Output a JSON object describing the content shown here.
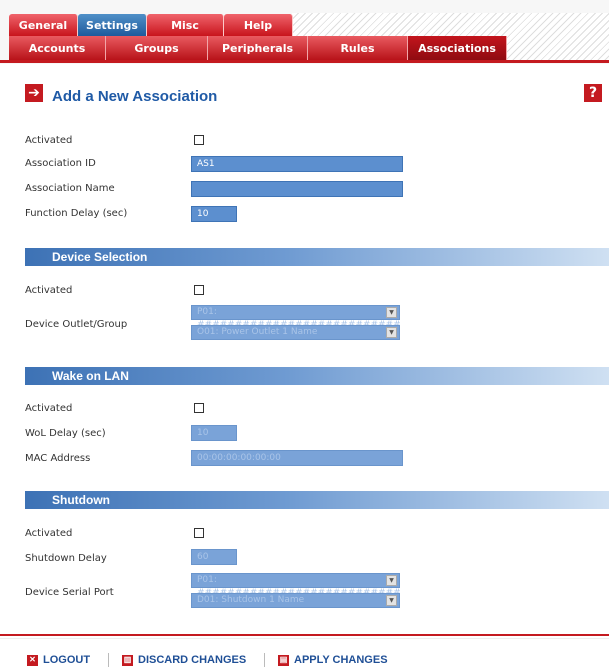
{
  "nav": {
    "primary_tabs": [
      {
        "label": "General",
        "active": false
      },
      {
        "label": "Settings",
        "active": true
      },
      {
        "label": "Misc",
        "active": false
      },
      {
        "label": "Help",
        "active": false
      }
    ],
    "secondary_tabs": [
      {
        "label": "Accounts",
        "active": false
      },
      {
        "label": "Groups",
        "active": false
      },
      {
        "label": "Peripherals",
        "active": false
      },
      {
        "label": "Rules",
        "active": false
      },
      {
        "label": "Associations",
        "active": true
      }
    ]
  },
  "page": {
    "title": "Add a New Association",
    "title_icon": "arrow-right-icon",
    "help_icon": "?"
  },
  "general": {
    "activated_label": "Activated",
    "activated_checked": false,
    "association_id_label": "Association ID",
    "association_id_value": "AS1",
    "association_name_label": "Association Name",
    "association_name_value": "",
    "function_delay_label": "Function Delay (sec)",
    "function_delay_value": "10"
  },
  "device_selection": {
    "title": "Device Selection",
    "activated_label": "Activated",
    "activated_checked": false,
    "outlet_group_label": "Device Outlet/Group",
    "select_1_value": "P01: ###########################",
    "select_2_value": "O01: Power Outlet 1 Name"
  },
  "wake_on_lan": {
    "title": "Wake on LAN",
    "activated_label": "Activated",
    "activated_checked": false,
    "wol_delay_label": "WoL Delay (sec)",
    "wol_delay_value": "10",
    "mac_address_label": "MAC Address",
    "mac_address_value": "00:00:00:00:00:00"
  },
  "shutdown": {
    "title": "Shutdown",
    "activated_label": "Activated",
    "activated_checked": false,
    "shutdown_delay_label": "Shutdown Delay",
    "shutdown_delay_value": "60",
    "serial_port_label": "Device Serial Port",
    "select_1_value": "P01: ###########################",
    "select_2_value": "D01: Shutdown 1 Name"
  },
  "footer": {
    "logout_label": "LOGOUT",
    "discard_label": "DISCARD CHANGES",
    "apply_label": "APPLY CHANGES"
  },
  "colors": {
    "brand_red": "#c41a20",
    "brand_blue": "#1f5aa6",
    "input_blue": "#5c8fcf"
  }
}
